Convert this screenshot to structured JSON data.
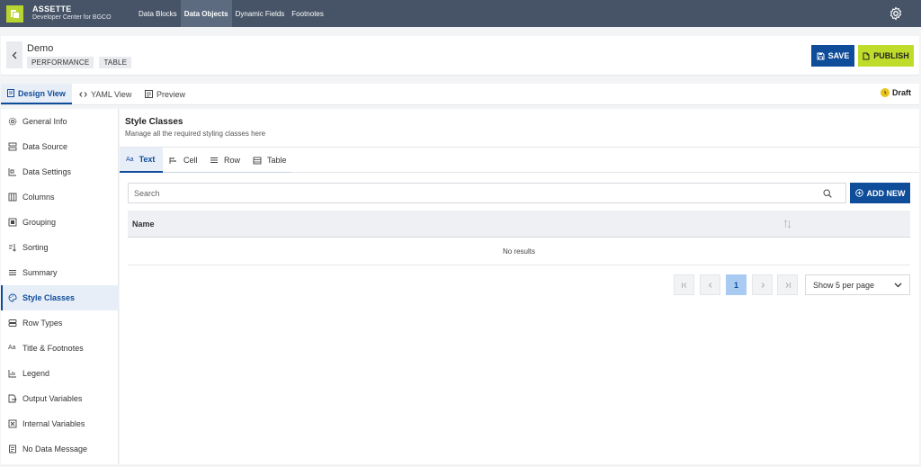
{
  "app": {
    "name": "ASSETTE",
    "subtitle": "Developer Center for BGCO"
  },
  "topnav": {
    "items": [
      {
        "label": "Data Blocks"
      },
      {
        "label": "Data Objects"
      },
      {
        "label": "Dynamic Fields"
      },
      {
        "label": "Footnotes"
      }
    ],
    "active": "Data Objects"
  },
  "header": {
    "title": "Demo",
    "tags": [
      "PERFORMANCE",
      "TABLE"
    ],
    "save_label": "SAVE",
    "publish_label": "PUBLISH"
  },
  "views": {
    "tabs": [
      {
        "label": "Design View",
        "icon": "design-view-icon"
      },
      {
        "label": "YAML View",
        "icon": "code-icon"
      },
      {
        "label": "Preview",
        "icon": "preview-icon"
      }
    ],
    "active": "Design View",
    "status": "Draft"
  },
  "sidebar": {
    "items": [
      {
        "label": "General Info",
        "icon": "gear-icon"
      },
      {
        "label": "Data Source",
        "icon": "data-source-icon"
      },
      {
        "label": "Data Settings",
        "icon": "data-settings-icon"
      },
      {
        "label": "Columns",
        "icon": "columns-icon"
      },
      {
        "label": "Grouping",
        "icon": "grouping-icon"
      },
      {
        "label": "Sorting",
        "icon": "sort-icon"
      },
      {
        "label": "Summary",
        "icon": "summary-icon"
      },
      {
        "label": "Style Classes",
        "icon": "palette-icon"
      },
      {
        "label": "Row Types",
        "icon": "row-types-icon"
      },
      {
        "label": "Title & Footnotes",
        "icon": "text-aa-icon"
      },
      {
        "label": "Legend",
        "icon": "legend-icon"
      },
      {
        "label": "Output Variables",
        "icon": "output-icon"
      },
      {
        "label": "Internal Variables",
        "icon": "internal-icon"
      },
      {
        "label": "No Data Message",
        "icon": "message-icon"
      }
    ],
    "active": "Style Classes"
  },
  "main": {
    "title": "Style Classes",
    "subtitle": "Manage all the required styling classes here",
    "tabs": [
      {
        "label": "Text",
        "icon": "text-aa-icon"
      },
      {
        "label": "Cell",
        "icon": "cell-icon"
      },
      {
        "label": "Row",
        "icon": "row-icon"
      },
      {
        "label": "Table",
        "icon": "table-icon"
      }
    ],
    "active_tab": "Text",
    "search": {
      "placeholder": "Search",
      "value": ""
    },
    "add_label": "ADD NEW",
    "table": {
      "columns": [
        "Name"
      ],
      "empty_text": "No results"
    },
    "pagination": {
      "current_page": "1",
      "per_page": "Show 5 per page"
    }
  },
  "colors": {
    "topbar": "#475467",
    "primary": "#0f4c9a",
    "publish": "#c0dc2a",
    "brand": "#b8d430",
    "draft": "#e9c21a"
  }
}
